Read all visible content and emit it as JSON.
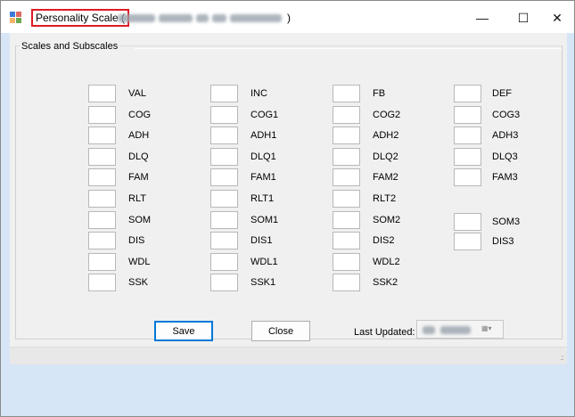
{
  "window": {
    "title_prefix": "Personality Scale (",
    "title_suffix": ")",
    "minimize_glyph": "—",
    "maximize_glyph": "☐",
    "close_glyph": "✕"
  },
  "group": {
    "title": "Scales and Subscales"
  },
  "scales": {
    "col1": [
      "VAL",
      "COG",
      "ADH",
      "DLQ",
      "FAM",
      "RLT",
      "SOM",
      "DIS",
      "WDL",
      "SSK"
    ],
    "col2": [
      "INC",
      "COG1",
      "ADH1",
      "DLQ1",
      "FAM1",
      "RLT1",
      "SOM1",
      "DIS1",
      "WDL1",
      "SSK1"
    ],
    "col3": [
      "FB",
      "COG2",
      "ADH2",
      "DLQ2",
      "FAM2",
      "RLT2",
      "SOM2",
      "DIS2",
      "WDL2",
      "SSK2"
    ],
    "col4a": [
      "DEF",
      "COG3",
      "ADH3",
      "DLQ3",
      "FAM3"
    ],
    "col4b": [
      "SOM3",
      "DIS3"
    ]
  },
  "buttons": {
    "save": "Save",
    "close": "Close"
  },
  "last_updated": {
    "label": "Last Updated:"
  },
  "icons": {
    "app": "windows-form-icon",
    "dropdown": "calendar-dropdown-icon"
  },
  "colors": {
    "title_highlight": "#e01b24",
    "focus": "#0078d7",
    "frame_bg": "#d7e6f7"
  }
}
